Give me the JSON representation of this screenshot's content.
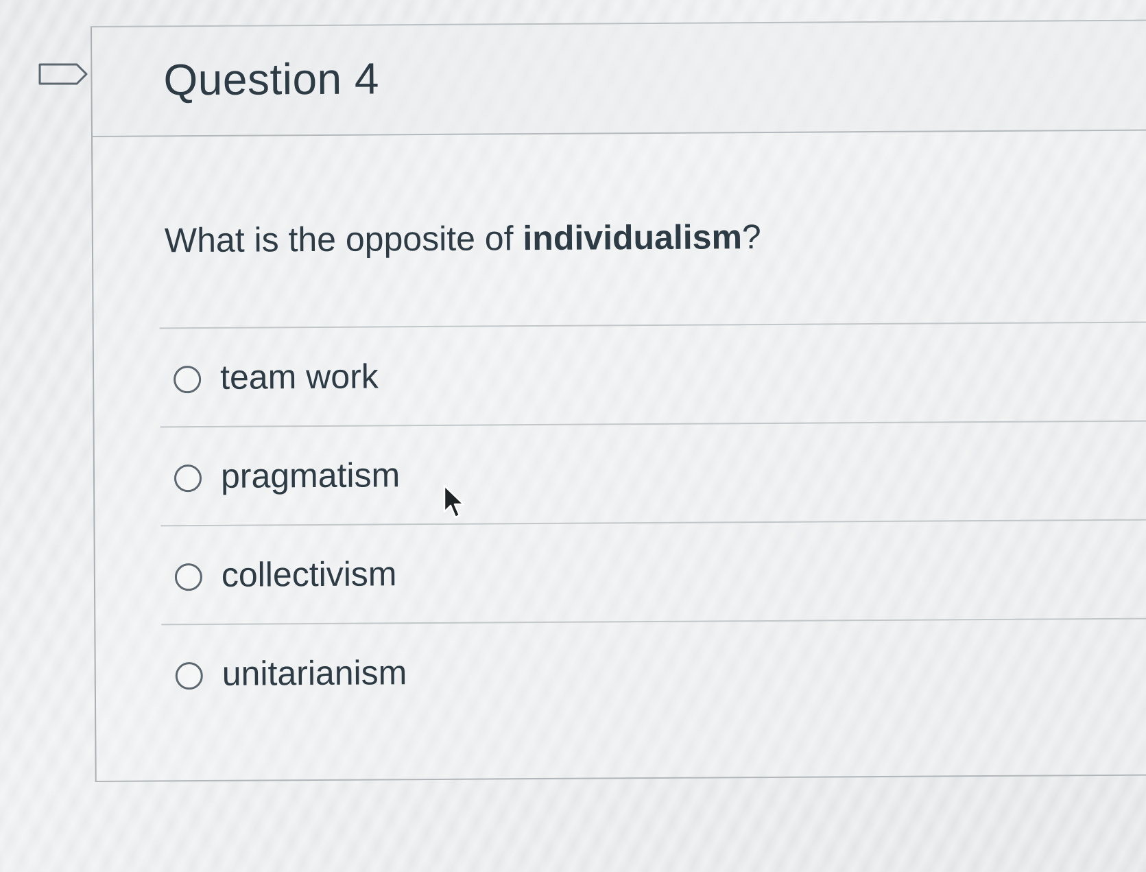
{
  "question": {
    "title": "Question 4",
    "text_prefix": "What is the opposite of ",
    "text_emphasis": "individualism",
    "text_suffix": "?"
  },
  "answers": [
    {
      "label": "team work",
      "selected": false
    },
    {
      "label": "pragmatism",
      "selected": false
    },
    {
      "label": "collectivism",
      "selected": false
    },
    {
      "label": "unitarianism",
      "selected": false
    }
  ],
  "icons": {
    "flag": "flag-question-icon",
    "cursor": "mouse-pointer-icon"
  },
  "colors": {
    "text": "#2d3b45",
    "border": "#b3b9bd",
    "radio_border": "#5c6770"
  }
}
